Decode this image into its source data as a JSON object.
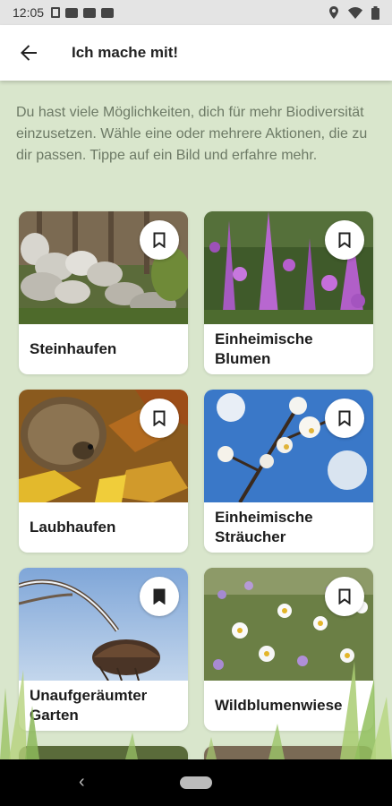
{
  "status_bar": {
    "time": "12:05",
    "icons": [
      "notification-icon",
      "news-icon",
      "youtube-icon",
      "youtube-icon",
      "location-icon",
      "wifi-icon",
      "battery-icon"
    ]
  },
  "app_bar": {
    "title": "Ich mache mit!",
    "back_icon": "arrow-left-icon"
  },
  "intro_text": "Du hast viele Möglichkeiten, dich für mehr Biodiversität einzusetzen. Wähle eine oder mehrere Aktionen, die zu dir passen. Tippe auf ein Bild und erfahre mehr.",
  "cards": [
    {
      "label": "Steinhaufen",
      "bookmarked": false
    },
    {
      "label": "Einheimische Blumen",
      "bookmarked": false
    },
    {
      "label": "Laubhaufen",
      "bookmarked": false
    },
    {
      "label": "Einheimische Sträucher",
      "bookmarked": false
    },
    {
      "label": "Unaufgeräumter Garten",
      "bookmarked": true
    },
    {
      "label": "Wildblumenwiese",
      "bookmarked": false
    }
  ],
  "colors": {
    "background": "#d9e6cc",
    "intro_text": "#6d7a66",
    "card": "#ffffff"
  }
}
